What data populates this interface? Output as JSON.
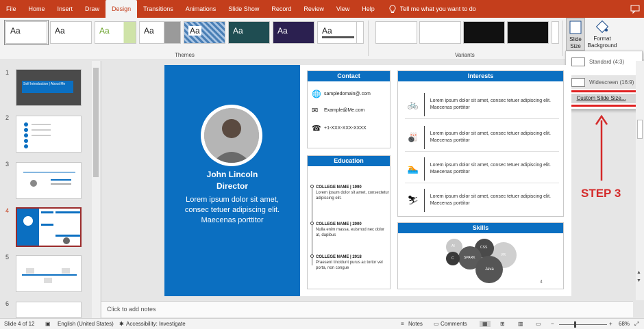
{
  "ribbon_tabs": [
    "File",
    "Home",
    "Insert",
    "Draw",
    "Design",
    "Transitions",
    "Animations",
    "Slide Show",
    "Record",
    "Review",
    "View",
    "Help"
  ],
  "active_tab": "Design",
  "tell_me": "Tell me what you want to do",
  "theme_sample": "Aa",
  "groups": {
    "themes": "Themes",
    "variants": "Variants"
  },
  "buttons": {
    "slide_size": "Slide Size",
    "slide_size_arrow": "▾",
    "format_background": "Format Background"
  },
  "slide_size_menu": {
    "standard": "Standard (4:3)",
    "widescreen": "Widescreen (16:9)",
    "custom": "Custom Slide Size..."
  },
  "annotation": "STEP 3",
  "thumbnails": {
    "numbers": [
      "1",
      "2",
      "3",
      "4",
      "5",
      "6"
    ],
    "selected": 4,
    "title_1": "Self Introduction | About Me"
  },
  "slide": {
    "name": "John Lincoln",
    "role": "Director",
    "bio": "Lorem ipsum dolor sit amet, consec tetuer adipiscing elit. Maecenas porttitor",
    "contact_title": "Contact",
    "contacts": [
      "sampledomain@.com",
      "Example@Me.com",
      "+1-XXX-XXX-XXXX"
    ],
    "education_title": "Education",
    "education": [
      {
        "head": "COLLEGE NAME | 1990",
        "text": "Lorem ipsum dolor sit amet, consectetur adipiscing elit."
      },
      {
        "head": "COLLEGE NAME | 2000",
        "text": "Nulla enim massa, euismod nec dolor at, dapibus"
      },
      {
        "head": "COLLEGE NAME | 2018",
        "text": "Praesent tincidunt purus ac tortor vel porta, non congue"
      }
    ],
    "interests_title": "Interests",
    "interests_text": "Lorem ipsum dolor sit amet, consec tetuer adipiscing elit. Maecenas porttitor",
    "interest_icons": [
      "cycling-icon",
      "bowling-icon",
      "swimming-icon",
      "skiing-icon"
    ],
    "skills_title": "Skills",
    "skills": [
      "AI",
      "CSS",
      "SPARK",
      "VR",
      "Java",
      "C"
    ],
    "page_number": "4"
  },
  "notes_placeholder": "Click to add notes",
  "status": {
    "slide": "Slide 4 of 12",
    "language": "English (United States)",
    "accessibility": "Accessibility: Investigate",
    "notes": "Notes",
    "comments": "Comments",
    "zoom": "68%"
  },
  "colors": {
    "brand": "#c43e1c",
    "slide_blue": "#0b6fc1",
    "step": "#d42a2a"
  }
}
